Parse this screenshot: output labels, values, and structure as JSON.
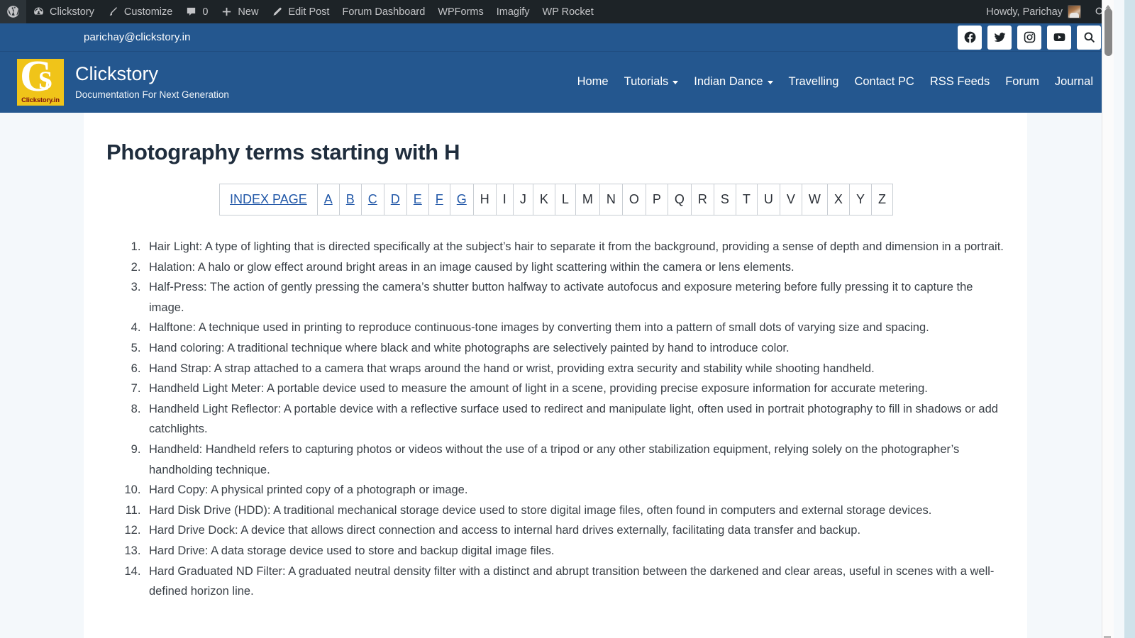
{
  "adminbar": {
    "items": [
      {
        "icon": "wordpress-logo-icon",
        "label": ""
      },
      {
        "icon": "dashboard-icon",
        "label": "Clickstory"
      },
      {
        "icon": "paintbrush-icon",
        "label": "Customize"
      },
      {
        "icon": "comment-bubble-icon",
        "label": "0"
      },
      {
        "icon": "plus-icon",
        "label": "New"
      },
      {
        "icon": "pencil-icon",
        "label": "Edit Post"
      },
      {
        "icon": "",
        "label": "Forum Dashboard"
      },
      {
        "icon": "",
        "label": "WPForms"
      },
      {
        "icon": "",
        "label": "Imagify"
      },
      {
        "icon": "",
        "label": "WP Rocket"
      }
    ],
    "howdy": "Howdy, Parichay",
    "search_icon": "search-icon"
  },
  "header": {
    "email": "parichay@clickstory.in",
    "social": [
      {
        "name": "facebook-icon"
      },
      {
        "name": "twitter-icon"
      },
      {
        "name": "instagram-icon"
      },
      {
        "name": "youtube-icon"
      },
      {
        "name": "search-icon"
      }
    ],
    "logo": {
      "letter_c": "C",
      "letter_s": "S",
      "wordmark": "Clickstory.in"
    },
    "site_title": "Clickstory",
    "tagline": "Documentation For Next Generation",
    "nav": [
      {
        "label": "Home",
        "has_dropdown": false
      },
      {
        "label": "Tutorials",
        "has_dropdown": true
      },
      {
        "label": "Indian Dance",
        "has_dropdown": true
      },
      {
        "label": "Travelling",
        "has_dropdown": false
      },
      {
        "label": "Contact PC",
        "has_dropdown": false
      },
      {
        "label": "RSS Feeds",
        "has_dropdown": false
      },
      {
        "label": "Forum",
        "has_dropdown": false
      },
      {
        "label": "Journal",
        "has_dropdown": false
      }
    ]
  },
  "main": {
    "page_title": "Photography terms starting with H",
    "alpha_index": {
      "index_label": "INDEX PAGE",
      "letters": [
        {
          "letter": "A",
          "is_link": true
        },
        {
          "letter": "B",
          "is_link": true
        },
        {
          "letter": "C",
          "is_link": true
        },
        {
          "letter": "D",
          "is_link": true
        },
        {
          "letter": "E",
          "is_link": true
        },
        {
          "letter": "F",
          "is_link": true
        },
        {
          "letter": "G",
          "is_link": true
        },
        {
          "letter": "H",
          "is_link": false
        },
        {
          "letter": "I",
          "is_link": false
        },
        {
          "letter": "J",
          "is_link": false
        },
        {
          "letter": "K",
          "is_link": false
        },
        {
          "letter": "L",
          "is_link": false
        },
        {
          "letter": "M",
          "is_link": false
        },
        {
          "letter": "N",
          "is_link": false
        },
        {
          "letter": "O",
          "is_link": false
        },
        {
          "letter": "P",
          "is_link": false
        },
        {
          "letter": "Q",
          "is_link": false
        },
        {
          "letter": "R",
          "is_link": false
        },
        {
          "letter": "S",
          "is_link": false
        },
        {
          "letter": "T",
          "is_link": false
        },
        {
          "letter": "U",
          "is_link": false
        },
        {
          "letter": "V",
          "is_link": false
        },
        {
          "letter": "W",
          "is_link": false
        },
        {
          "letter": "X",
          "is_link": false
        },
        {
          "letter": "Y",
          "is_link": false
        },
        {
          "letter": "Z",
          "is_link": false
        }
      ]
    },
    "terms": [
      "Hair Light: A type of lighting that is directed specifically at the subject’s hair to separate it from the background, providing a sense of depth and dimension in a portrait.",
      "Halation: A halo or glow effect around bright areas in an image caused by light scattering within the camera or lens elements.",
      "Half-Press: The action of gently pressing the camera’s shutter button halfway to activate autofocus and exposure metering before fully pressing it to capture the image.",
      "Halftone: A technique used in printing to reproduce continuous-tone images by converting them into a pattern of small dots of varying size and spacing.",
      "Hand coloring: A traditional technique where black and white photographs are selectively painted by hand to introduce color.",
      "Hand Strap: A strap attached to a camera that wraps around the hand or wrist, providing extra security and stability while shooting handheld.",
      "Handheld Light Meter: A portable device used to measure the amount of light in a scene, providing precise exposure information for accurate metering.",
      "Handheld Light Reflector: A portable device with a reflective surface used to redirect and manipulate light, often used in portrait photography to fill in shadows or add catchlights.",
      "Handheld: Handheld refers to capturing photos or videos without the use of a tripod or any other stabilization equipment, relying solely on the photographer’s handholding technique.",
      "Hard Copy: A physical printed copy of a photograph or image.",
      "Hard Disk Drive (HDD): A traditional mechanical storage device used to store digital image files, often found in computers and external storage devices.",
      "Hard Drive Dock: A device that allows direct connection and access to internal hard drives externally, facilitating data transfer and backup.",
      "Hard Drive: A data storage device used to store and backup digital image files.",
      "Hard Graduated ND Filter: A graduated neutral density filter with a distinct and abrupt transition between the darkened and clear areas, useful in scenes with a well-defined horizon line."
    ]
  },
  "colors": {
    "admin_bar": "#1d2327",
    "header_blue": "#24578f",
    "link_blue": "#2258a8",
    "logo_yellow": "#f0c419",
    "page_bg": "#f4f8fb"
  }
}
